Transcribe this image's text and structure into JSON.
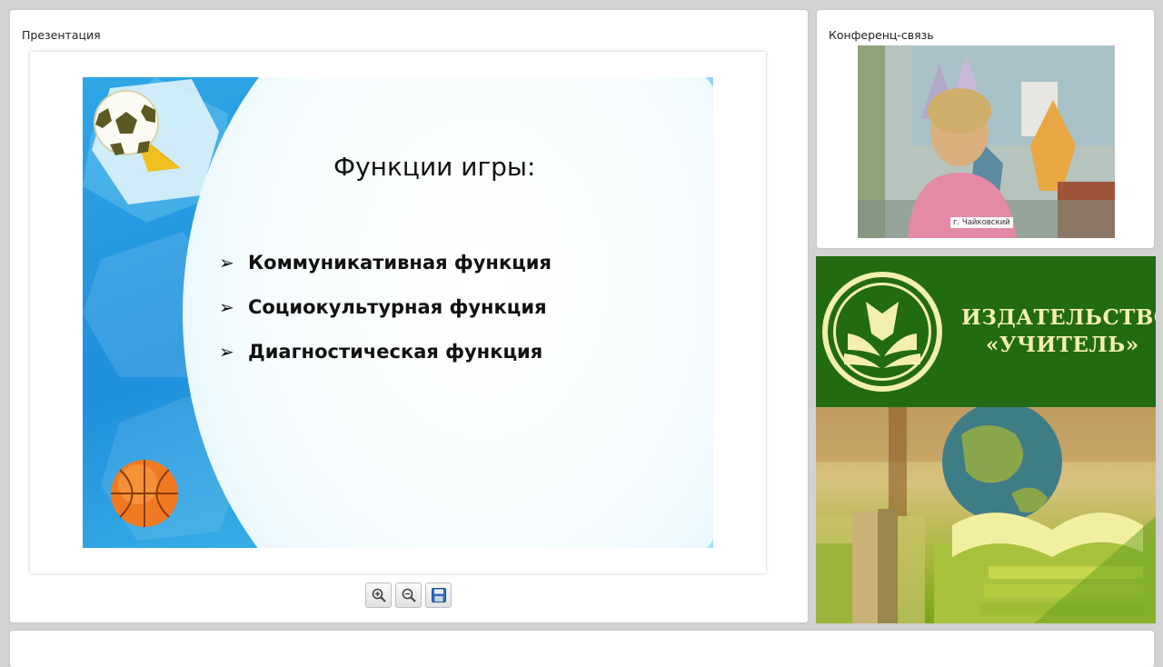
{
  "presentation": {
    "title": "Презентация",
    "slide": {
      "heading": "Функции игры:",
      "items": [
        "Коммуникативная функция",
        "Социокультурная функция",
        "Диагностическая функция"
      ],
      "bullet": "➢"
    },
    "toolbar": {
      "zoom_in_icon": "zoom-in-icon",
      "zoom_out_icon": "zoom-out-icon",
      "save_icon": "floppy-disk-icon"
    }
  },
  "conference": {
    "title": "Конференц-связь",
    "participant_label": "г. Чайковский"
  },
  "banner": {
    "line1": "ИЗДАТЕЛЬСТВО",
    "line2": "«УЧИТЕЛЬ»"
  },
  "colors": {
    "slide_blue": "#1e8fdc",
    "banner_green": "#226b12",
    "banner_text": "#f2efb0"
  }
}
